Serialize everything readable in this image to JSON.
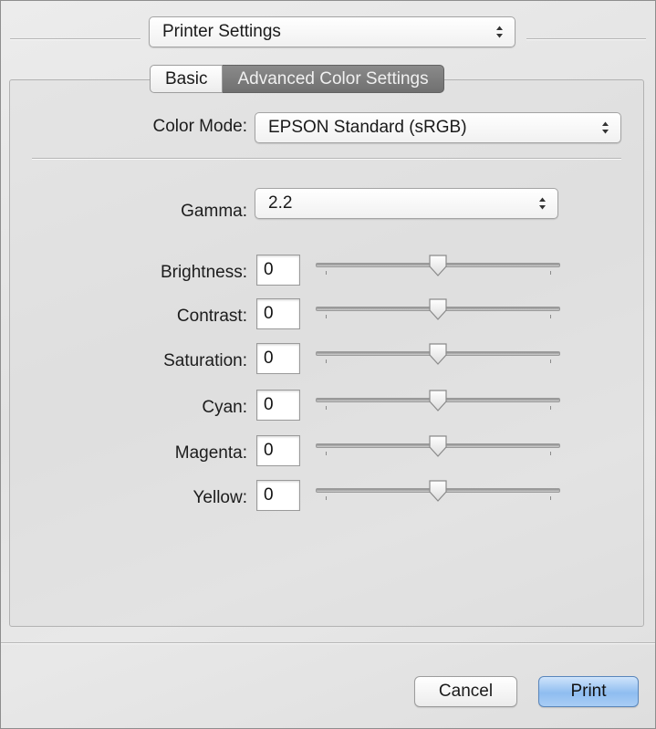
{
  "header": {
    "preset_popup_value": "Printer Settings"
  },
  "tabs": [
    {
      "label": "Basic",
      "selected": false
    },
    {
      "label": "Advanced Color Settings",
      "selected": true
    }
  ],
  "color_mode": {
    "label": "Color Mode:",
    "value": "EPSON Standard (sRGB)"
  },
  "gamma": {
    "label": "Gamma:",
    "value": "2.2"
  },
  "adjustments": [
    {
      "label": "Brightness:",
      "value": "0",
      "slider_level": 0.5
    },
    {
      "label": "Contrast:",
      "value": "0",
      "slider_level": 0.5
    },
    {
      "label": "Saturation:",
      "value": "0",
      "slider_level": 0.5
    },
    {
      "label": "Cyan:",
      "value": "0",
      "slider_level": 0.5
    },
    {
      "label": "Magenta:",
      "value": "0",
      "slider_level": 0.5
    },
    {
      "label": "Yellow:",
      "value": "0",
      "slider_level": 0.5
    }
  ],
  "footer": {
    "cancel_label": "Cancel",
    "print_label": "Print"
  },
  "colors": {
    "print_button": "#8fbdf0",
    "selected_tab": "#7a7a7a"
  },
  "icons": {
    "popup_arrows": "up-down-arrows-icon",
    "slider_thumb": "slider-thumb-icon"
  }
}
